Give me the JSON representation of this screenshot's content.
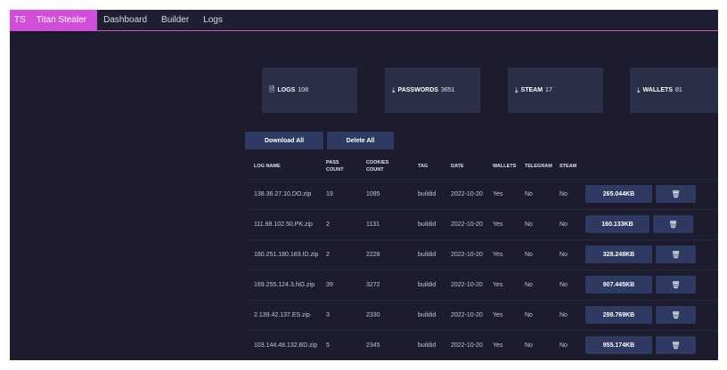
{
  "nav": {
    "brand_short": "TS",
    "brand_name": "Titan Stealer",
    "links": [
      "Dashboard",
      "Builder",
      "Logs"
    ]
  },
  "stats": [
    {
      "label": "LOGS",
      "value": "108",
      "icon": "document-icon"
    },
    {
      "label": "PASSWORDS",
      "value": "3651",
      "icon": "download-icon"
    },
    {
      "label": "STEAM",
      "value": "17",
      "icon": "download-icon"
    },
    {
      "label": "WALLETS",
      "value": "81",
      "icon": "download-icon"
    }
  ],
  "actions": {
    "download_all": "Download All",
    "delete_all": "Delete All"
  },
  "table": {
    "headers": {
      "log_name": "LOG NAME",
      "pass_count": "PASS COUNT",
      "cookies_count": "COOKIES COUNT",
      "tag": "TAG",
      "date": "DATE",
      "wallets": "WALLETS",
      "telegram": "TELEGRAM",
      "steam": "STEAM"
    },
    "rows": [
      {
        "name": "138.36.27.10.DO.zip",
        "pass": "19",
        "cookies": "1095",
        "tag": "buildid",
        "date": "2022-10-20",
        "wallets": "Yes",
        "telegram": "No",
        "steam": "No",
        "size": "265.044KB"
      },
      {
        "name": "111.88.102.50.PK.zip",
        "pass": "2",
        "cookies": "1131",
        "tag": "buildid",
        "date": "2022-10-20",
        "wallets": "Yes",
        "telegram": "No",
        "steam": "No",
        "size": "160.133KB"
      },
      {
        "name": "180.251.180.183.ID.zip",
        "pass": "2",
        "cookies": "2228",
        "tag": "buildid",
        "date": "2022-10-20",
        "wallets": "Yes",
        "telegram": "No",
        "steam": "No",
        "size": "328.248KB"
      },
      {
        "name": "169.255.124.3.NG.zip",
        "pass": "39",
        "cookies": "3272",
        "tag": "buildid",
        "date": "2022-10-20",
        "wallets": "Yes",
        "telegram": "No",
        "steam": "No",
        "size": "907.445KB"
      },
      {
        "name": "2.139.42.137.ES.zip",
        "pass": "3",
        "cookies": "2330",
        "tag": "buildid",
        "date": "2022-10-20",
        "wallets": "Yes",
        "telegram": "No",
        "steam": "No",
        "size": "298.769KB"
      },
      {
        "name": "103.144.48.132.BD.zip",
        "pass": "5",
        "cookies": "2345",
        "tag": "buildid",
        "date": "2022-10-20",
        "wallets": "Yes",
        "telegram": "No",
        "steam": "No",
        "size": "955.174KB"
      }
    ]
  },
  "colors": {
    "accent": "#d14fd8",
    "background": "#1c1c2e",
    "card": "#2b2f48",
    "button": "#2e3a62"
  }
}
